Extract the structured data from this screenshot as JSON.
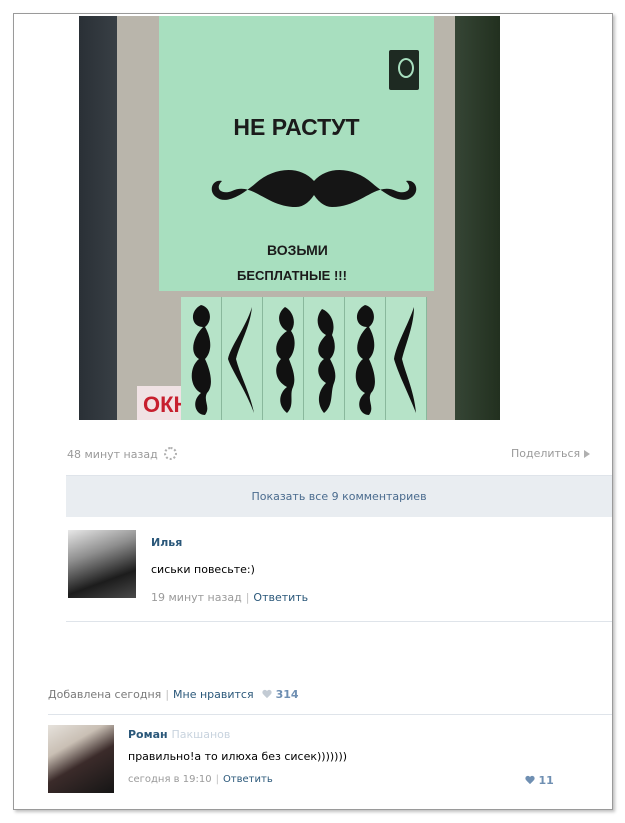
{
  "post": {
    "poster": {
      "headline": "НЕ РАСТУТ",
      "line1": "ВОЗЬМИ",
      "line2": "БЕСПЛАТНЫЕ !!!",
      "sign_text": "ОКНА"
    },
    "time": "48 минут назад",
    "share_label": "Поделиться",
    "show_all_label": "Показать все 9 комментариев"
  },
  "comment1": {
    "author": "Илья",
    "author_surname": "",
    "text": "сиськи повесьте:)",
    "time": "19 минут назад",
    "reply_label": "Ответить"
  },
  "footer": {
    "added": "Добавлена сегодня",
    "like_label": "Мне нравится",
    "like_count": "314"
  },
  "comment2": {
    "author": "Роман",
    "author_surname": "Пакшанов",
    "text": "правильно!а то илюха без сисек)))))))",
    "time": "сегодня в 19:10",
    "reply_label": "Ответить",
    "likes": "11"
  },
  "colors": {
    "link": "#2b587a",
    "poster": "#a8dfbf",
    "accent_heart": "#6f8fb2"
  },
  "icons": [
    "settings-icon",
    "share-arrow-icon",
    "heart-icon"
  ]
}
